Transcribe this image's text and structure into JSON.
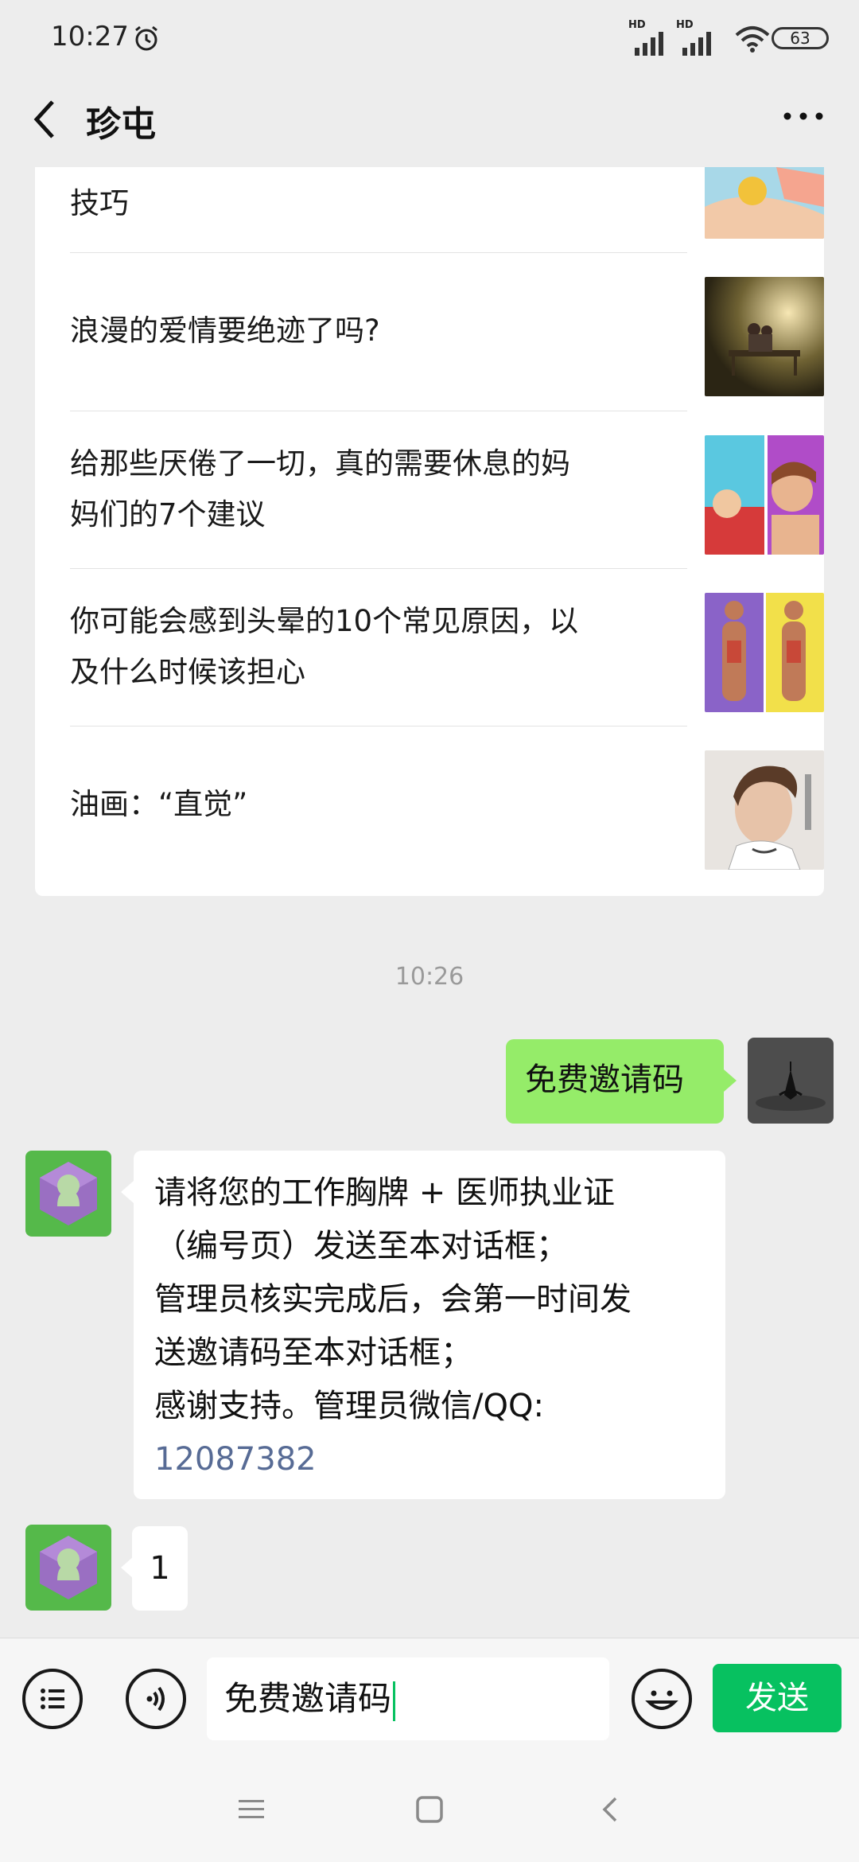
{
  "status_bar": {
    "time": "10:27",
    "network_1": "HD",
    "network_2": "HD",
    "battery": "63"
  },
  "header": {
    "title": "珍屯",
    "back_icon": "chevron-left-icon",
    "more_icon": "more-dots-icon"
  },
  "article_card": {
    "items": [
      {
        "title": "技巧"
      },
      {
        "title": "浪漫的爱情要绝迹了吗?"
      },
      {
        "title_line1": "给那些厌倦了一切，真的需要休息的妈",
        "title_line2": "妈们的7个建议"
      },
      {
        "title_line1": "你可能会感到头晕的10个常见原因，以",
        "title_line2": "及什么时候该担心"
      },
      {
        "title": "油画：“直觉”"
      }
    ]
  },
  "chat": {
    "timestamp": "10:26",
    "messages": [
      {
        "side": "right",
        "text": "免费邀请码"
      },
      {
        "side": "left",
        "lines": [
          "请将您的工作胸牌 + 医师执业证",
          "（编号页）发送至本对话框；",
          "管理员核实完成后，会第一时间发",
          "送邀请码至本对话框；",
          "感谢支持。管理员微信/QQ:"
        ],
        "link": "12087382"
      },
      {
        "side": "left",
        "text": "1"
      }
    ]
  },
  "input_bar": {
    "value": "免费邀请码",
    "send_label": "发送",
    "menu_icon": "list-menu-icon",
    "voice_icon": "voice-icon",
    "emoji_icon": "emoji-icon"
  },
  "colors": {
    "accent": "#07c160",
    "bubble_self": "#95ec69",
    "link": "#576b95",
    "background": "#ededed"
  }
}
